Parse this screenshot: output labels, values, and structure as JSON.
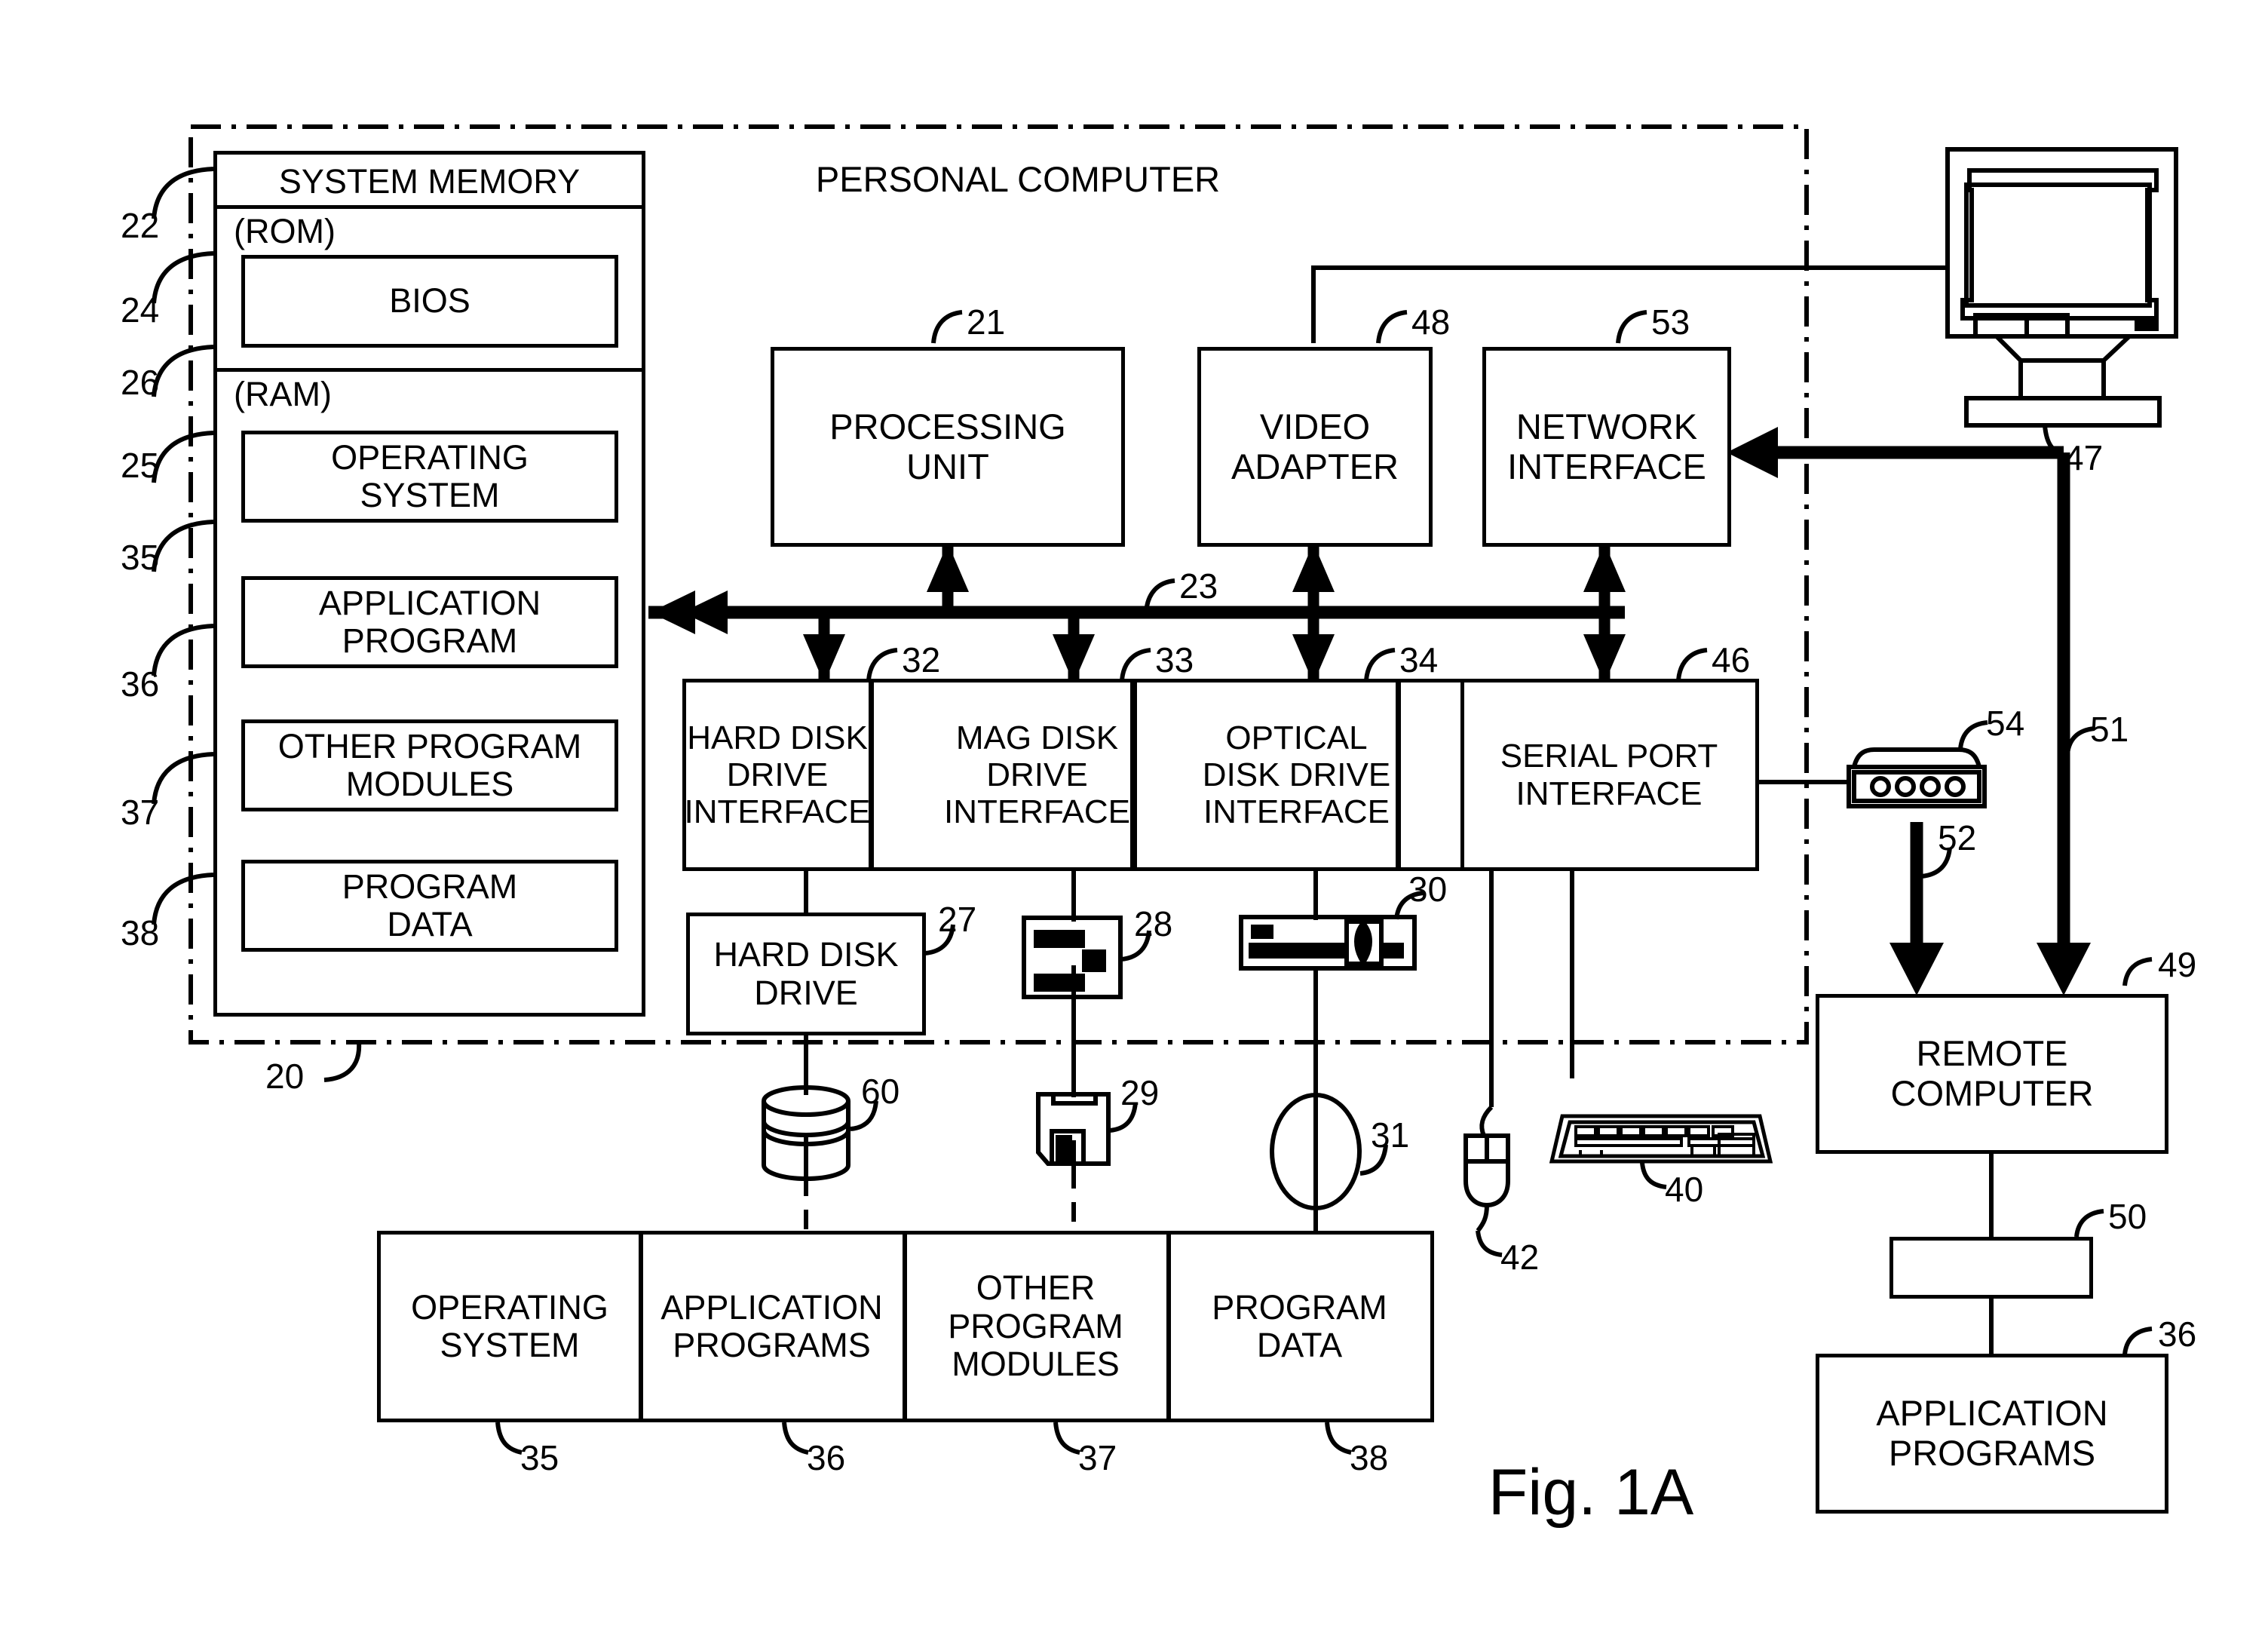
{
  "figure": {
    "caption": "Fig. 1A",
    "outer_label": "20",
    "personal_computer_title": "PERSONAL COMPUTER"
  },
  "system_memory": {
    "title": "SYSTEM MEMORY",
    "title_ref": "22",
    "rom_label": "(ROM)",
    "rom_ref": "24",
    "bios_label": "BIOS",
    "bios_ref": "26",
    "ram_label": "(RAM)",
    "ram_ref": "25",
    "items": [
      {
        "label": "OPERATING\nSYSTEM",
        "ref": "35"
      },
      {
        "label": "APPLICATION\nPROGRAM",
        "ref": "36"
      },
      {
        "label": "OTHER PROGRAM\nMODULES",
        "ref": "37"
      },
      {
        "label": "PROGRAM\nDATA",
        "ref": "38"
      }
    ]
  },
  "core": {
    "processing_unit": {
      "label": "PROCESSING\nUNIT",
      "ref": "21"
    },
    "video_adapter": {
      "label": "VIDEO\nADAPTER",
      "ref": "48"
    },
    "network_interface": {
      "label": "NETWORK\nINTERFACE",
      "ref": "53"
    },
    "bus_ref": "23"
  },
  "interfaces": [
    {
      "label": "HARD DISK\nDRIVE\nINTERFACE",
      "ref": "32"
    },
    {
      "label": "MAG DISK\nDRIVE\nINTERFACE",
      "ref": "33"
    },
    {
      "label": "OPTICAL\nDISK DRIVE\nINTERFACE",
      "ref": "34"
    },
    {
      "label": "SERIAL PORT\nINTERFACE",
      "ref": "46"
    }
  ],
  "drives": {
    "hard_disk_drive": {
      "label": "HARD DISK\nDRIVE",
      "ref": "27"
    },
    "mag_disk_drive_ref": "28",
    "optical_disk_drive_ref": "30",
    "hard_disk_media_ref": "60",
    "floppy_disk_ref": "29",
    "optical_disc_ref": "31"
  },
  "peripherals": {
    "mouse_ref": "42",
    "keyboard_ref": "40",
    "monitor_ref": "47",
    "modem_ref": "54",
    "wan_link_ref": "52",
    "lan_link_ref": "51"
  },
  "storage_contents": [
    {
      "label": "OPERATING\nSYSTEM",
      "ref": "35"
    },
    {
      "label": "APPLICATION\nPROGRAMS",
      "ref": "36"
    },
    {
      "label": "OTHER\nPROGRAM\nMODULES",
      "ref": "37"
    },
    {
      "label": "PROGRAM\nDATA",
      "ref": "38"
    }
  ],
  "remote": {
    "computer": {
      "label": "REMOTE\nCOMPUTER",
      "ref": "49"
    },
    "memory_ref": "50",
    "application_programs": {
      "label": "APPLICATION\nPROGRAMS",
      "ref": "36"
    }
  },
  "colors": {
    "ink": "#000000",
    "paper": "#ffffff"
  }
}
